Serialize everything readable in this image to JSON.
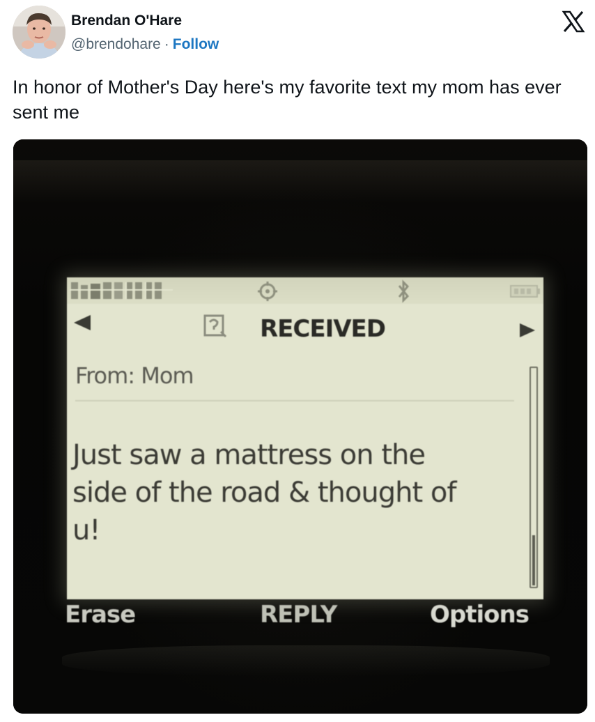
{
  "author": {
    "name": "Brendan O'Hare",
    "handle": "@brendohare",
    "separator": "·",
    "follow_label": "Follow"
  },
  "logo_icon": "x-logo-icon",
  "tweet": {
    "text": "In honor of Mother's Day here's my favorite text my mom has ever sent me"
  },
  "media": {
    "phone_screen": {
      "header_title": "RECEIVED",
      "from_line": "From: Mom",
      "message_lines": [
        "Just saw a mattress on the",
        "side of the road & thought of",
        "u!"
      ],
      "softkeys": {
        "left": "Erase",
        "center": "REPLY",
        "right": "Options"
      },
      "status_icons": [
        "signal-icon",
        "gps-icon",
        "bluetooth-icon",
        "battery-icon"
      ]
    }
  },
  "colors": {
    "text_primary": "#0f1419",
    "text_secondary": "#536471",
    "link": "#1d77c2",
    "phone_screen": "#e3e5cf"
  }
}
